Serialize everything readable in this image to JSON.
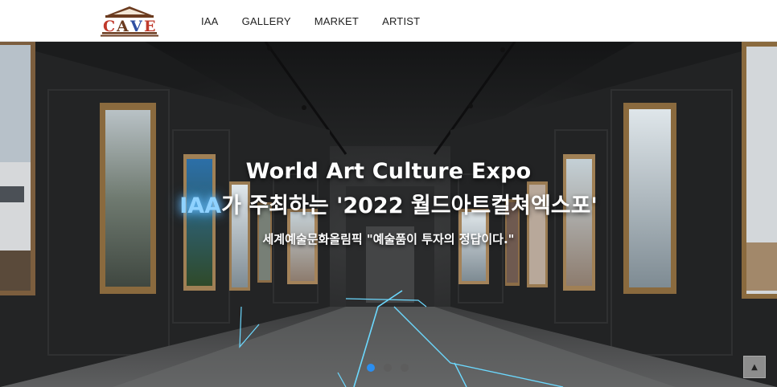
{
  "brand": {
    "logo_text": "CAVE"
  },
  "nav": {
    "items": [
      {
        "label": "IAA"
      },
      {
        "label": "GALLERY"
      },
      {
        "label": "MARKET"
      },
      {
        "label": "ARTIST"
      }
    ]
  },
  "hero": {
    "title_line1": "World Art Culture Expo",
    "title_line2_highlight": "IAA",
    "title_line2_rest": "가 주최하는 '2022 월드아트컬쳐엑스포'",
    "subtitle": "세계예술문화올림픽 \"예술품이 투자의 정답이다.\"",
    "slides": {
      "count": 3,
      "active_index": 0
    }
  },
  "controls": {
    "scroll_top_icon": "arrow-up-icon",
    "scroll_top_symbol": "▲"
  },
  "colors": {
    "highlight": "#8fd2ff",
    "dot_active": "#2b8ef0",
    "dot_inactive": "#5d5d5d",
    "logo_red": "#c0392b",
    "logo_blue": "#2f4fa2",
    "logo_brown": "#6b3b1f"
  }
}
